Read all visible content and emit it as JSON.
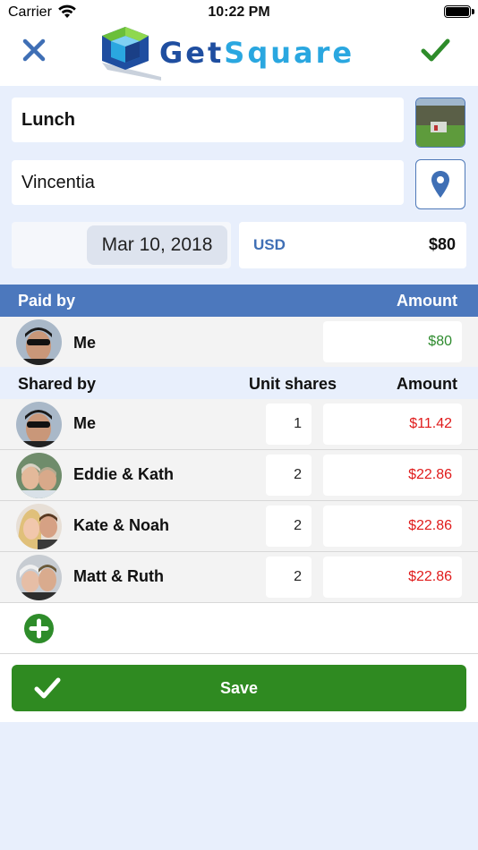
{
  "status_bar": {
    "carrier": "Carrier",
    "time": "10:22 PM"
  },
  "nav": {
    "logo_part1": "Get",
    "logo_part2": "Square",
    "close_icon": "close-icon",
    "done_icon": "checkmark-icon"
  },
  "form": {
    "title_value": "Lunch",
    "location_value": "Vincentia",
    "date_value": "Mar 10, 2018",
    "currency_code": "USD",
    "total_amount": "$80"
  },
  "paid_by": {
    "header_label": "Paid by",
    "header_amount": "Amount",
    "payer": {
      "name": "Me",
      "amount": "$80"
    }
  },
  "shared_by": {
    "header_label": "Shared by",
    "header_shares": "Unit shares",
    "header_amount": "Amount",
    "people": [
      {
        "name": "Me",
        "shares": "1",
        "amount": "$11.42"
      },
      {
        "name": "Eddie & Kath",
        "shares": "2",
        "amount": "$22.86"
      },
      {
        "name": "Kate & Noah",
        "shares": "2",
        "amount": "$22.86"
      },
      {
        "name": "Matt & Ruth",
        "shares": "2",
        "amount": "$22.86"
      }
    ]
  },
  "save_label": "Save",
  "colors": {
    "accent_blue": "#4c78bd",
    "save_green": "#2f8a21",
    "paid_amount": "#2e8b2e",
    "owed_amount": "#e01b1b"
  }
}
